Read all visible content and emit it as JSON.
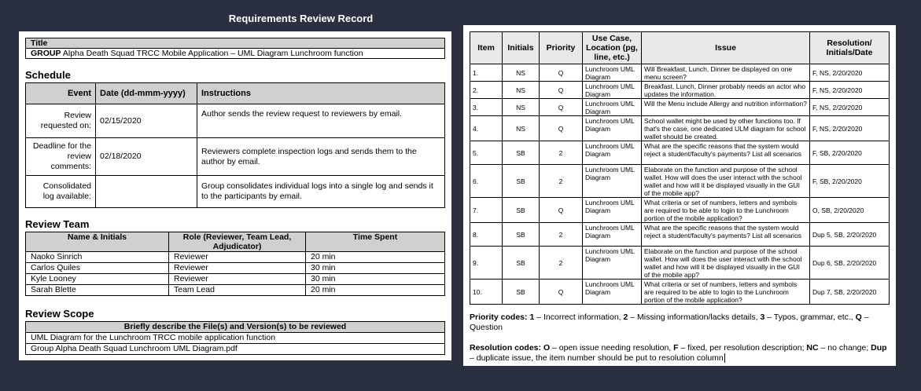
{
  "page_title": "Requirements Review Record",
  "title_box": {
    "header": "Title",
    "group_label": "GROUP",
    "value": " Alpha Death Squad TRCC Mobile Application – UML Diagram Lunchroom function"
  },
  "schedule": {
    "heading": "Schedule",
    "columns": [
      "Event",
      "Date (dd-mmm-yyyy)",
      "Instructions"
    ],
    "rows": [
      {
        "event": "Review requested on:",
        "date": "02/15/2020",
        "instructions": "Author sends the review request to reviewers by email."
      },
      {
        "event": "Deadline for the review comments:",
        "date": "02/18/2020",
        "instructions": "Reviewers complete inspection logs and sends them to the author by email."
      },
      {
        "event": "Consolidated log available:",
        "date": "",
        "instructions": "Group consolidates individual logs into a single log and sends it to the participants by email."
      }
    ]
  },
  "team": {
    "heading": "Review Team",
    "columns": [
      "Name & Initials",
      "Role (Reviewer, Team Lead, Adjudicator)",
      "Time Spent"
    ],
    "rows": [
      {
        "name": "Naoko Sinrich",
        "role": "Reviewer",
        "time": "20 min"
      },
      {
        "name": "Carlos Quiles",
        "role": "Reviewer",
        "time": "30 min"
      },
      {
        "name": "Kyle Looney",
        "role": "Reviewer",
        "time": "30 min"
      },
      {
        "name": "Sarah Blette",
        "role": "Team Lead",
        "time": "20 min"
      }
    ]
  },
  "scope": {
    "heading": "Review Scope",
    "header": "Briefly describe the File(s) and Version(s) to be reviewed",
    "rows": [
      "UML Diagram for the Lunchroom TRCC mobile application function",
      "Group Alpha Death Squad Lunchroom UML Diagram.pdf"
    ]
  },
  "issues": {
    "columns": [
      "Item",
      "Initials",
      "Priority",
      "Use Case, Location (pg, line, etc.)",
      "Issue",
      "Resolution/ Initials/Date"
    ],
    "rows": [
      {
        "item": "1.",
        "initials": "NS",
        "priority": "Q",
        "location": "Lunchroom UML Diagram",
        "issue": "Will Breakfast, Lunch, Dinner be displayed on one menu screen?",
        "resolution": "F, NS, 2/20/2020"
      },
      {
        "item": "2.",
        "initials": "NS",
        "priority": "Q",
        "location": "Lunchroom UML Diagram",
        "issue": "Breakfast, Lunch, Dinner probably needs an actor who updates the information.",
        "resolution": "F, NS, 2/20/2020"
      },
      {
        "item": "3.",
        "initials": "NS",
        "priority": "Q",
        "location": "Lunchroom UML Diagram",
        "issue": "Will the Menu include Allergy and nutrition information?",
        "resolution": "F, NS, 2/20/2020"
      },
      {
        "item": "4.",
        "initials": "NS",
        "priority": "Q",
        "location": "Lunchroom UML Diagram",
        "issue": "School wallet might be used by other functions too. If that's the case, one dedicated ULM diagram for school wallet should be created.",
        "resolution": "F, NS, 2/20/2020"
      },
      {
        "item": "5.",
        "initials": "SB",
        "priority": "2",
        "location": "Lunchroom UML Diagram",
        "issue": "What are the specific reasons that the system would reject a student/faculty's payments? List all scenarios",
        "resolution": "F, SB, 2/20/2020"
      },
      {
        "item": "6.",
        "initials": "SB",
        "priority": "2",
        "location": "Lunchroom UML Diagram",
        "issue": "Elaborate on the function and purpose of the school wallet. How will does the user interact with the school wallet and how will it be displayed visually in the GUI of the mobile app?",
        "resolution": "F, SB, 2/20/2020"
      },
      {
        "item": "7.",
        "initials": "SB",
        "priority": "Q",
        "location": "Lunchroom UML Diagram",
        "issue": "What criteria or set of numbers, letters and symbols are required to be able to login to the Lunchroom portion of the mobile application?",
        "resolution": "O, SB, 2/20/2020"
      },
      {
        "item": "8.",
        "initials": "SB",
        "priority": "2",
        "location": "Lunchroom UML Diagram",
        "issue": "What are the specific reasons that the system would reject a student/faculty's payments? List all scenarios",
        "resolution": "Dup 5, SB, 2/20/2020"
      },
      {
        "item": "9.",
        "initials": "SB",
        "priority": "2",
        "location": "Lunchroom UML Diagram",
        "issue": "Elaborate on the function and purpose of the school wallet. How will does the user interact with the school wallet and how will it be displayed visually in the GUI of the mobile app?",
        "resolution": "Dup 6, SB, 2/20/2020"
      },
      {
        "item": "10.",
        "initials": "SB",
        "priority": "Q",
        "location": "Lunchroom UML Diagram",
        "issue": "What criteria or set of numbers, letters and symbols are required to be able to login to the Lunchroom portion of the mobile application?",
        "resolution": "Dup 7, SB, 2/20/2020"
      }
    ]
  },
  "codes": {
    "priority_label": "Priority codes:",
    "priority_text_1": "1",
    "priority_desc_1": " – Incorrect information, ",
    "priority_text_2": "2",
    "priority_desc_2": " – Missing information/lacks details, ",
    "priority_text_3": "3",
    "priority_desc_3": " – Typos, grammar, etc., ",
    "priority_text_q": "Q",
    "priority_desc_q": " – Question",
    "resolution_label": "Resolution codes:",
    "res_o": "O",
    "res_o_desc": " – open issue needing resolution, ",
    "res_f": "F",
    "res_f_desc": " – fixed, per resolution description; ",
    "res_nc": "NC",
    "res_nc_desc": " – no change; ",
    "res_dup": "Dup",
    "res_dup_desc": " – duplicate issue, the item number should be put to resolution column"
  }
}
